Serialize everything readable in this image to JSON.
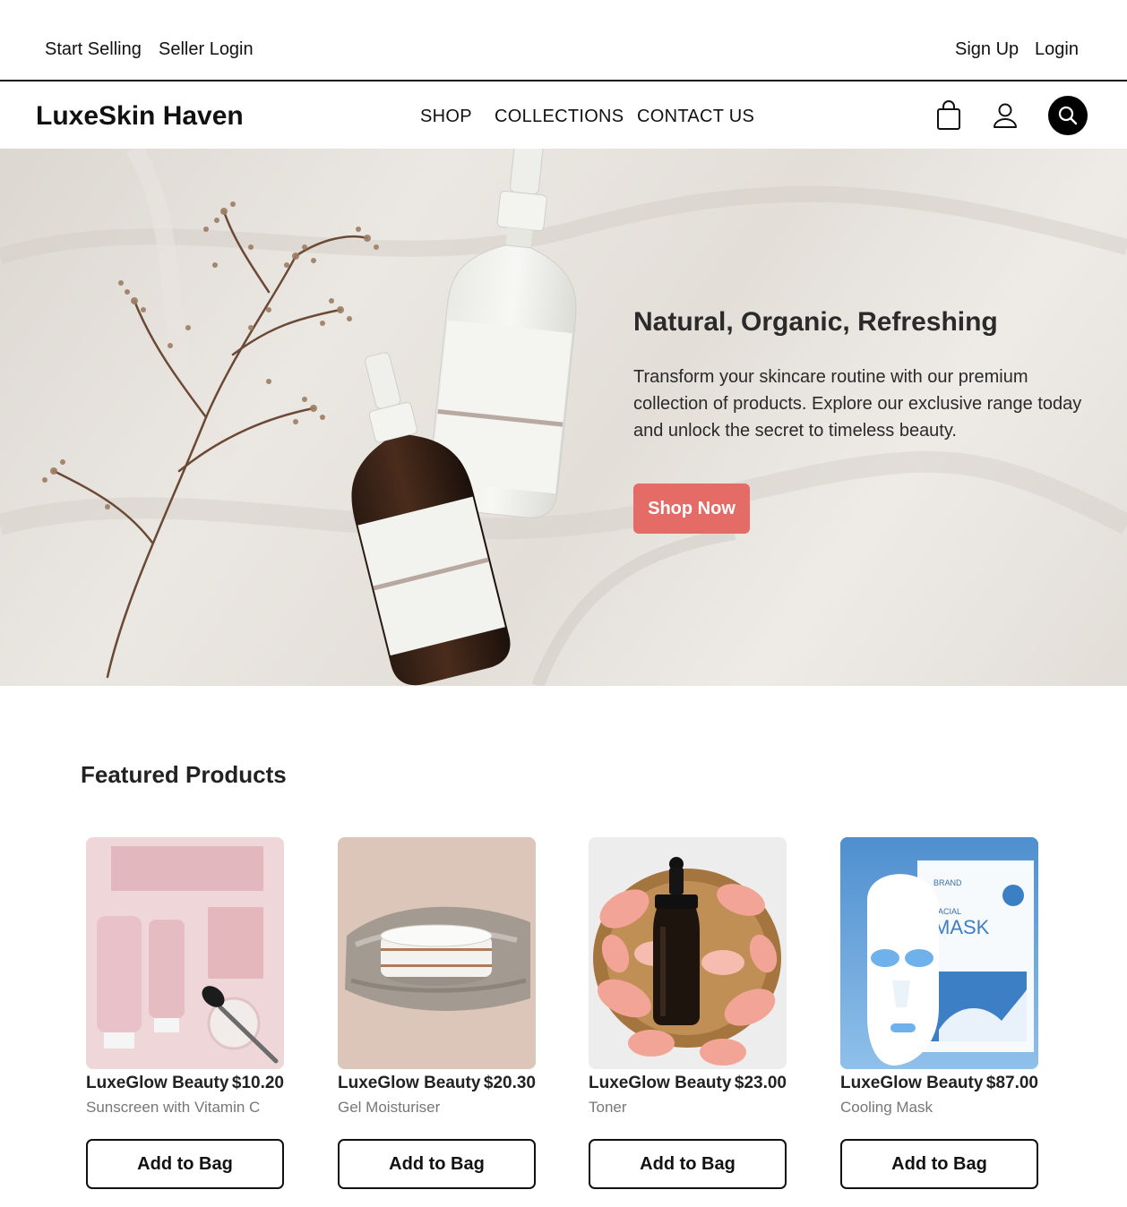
{
  "topbar": {
    "start_selling": "Start Selling",
    "seller_login": "Seller Login",
    "sign_up": "Sign Up",
    "login": "Login"
  },
  "header": {
    "brand": "LuxeSkin Haven",
    "nav": [
      "SHOP",
      "COLLECTIONS",
      "CONTACT US"
    ],
    "icons": [
      "bag-icon",
      "user-icon",
      "search-icon"
    ]
  },
  "hero": {
    "title": "Natural, Organic, Refreshing",
    "text": "Transform your skincare routine with our premium collection of products. Explore our exclusive range today and unlock the secret to timeless beauty.",
    "button": "Shop Now",
    "button_color": "#e46b66"
  },
  "featured": {
    "title": "Featured Products",
    "products": [
      {
        "brand": "LuxeGlow Beauty",
        "price": "$10.20",
        "name": "Sunscreen with Vitamin C",
        "cta": "Add to Bag"
      },
      {
        "brand": "LuxeGlow Beauty",
        "price": "$20.30",
        "name": "Gel Moisturiser",
        "cta": "Add to Bag"
      },
      {
        "brand": "LuxeGlow Beauty",
        "price": "$23.00",
        "name": "Toner",
        "cta": "Add to Bag"
      },
      {
        "brand": "LuxeGlow Beauty",
        "price": "$87.00",
        "name": "Cooling Mask",
        "cta": "Add to Bag"
      }
    ]
  }
}
